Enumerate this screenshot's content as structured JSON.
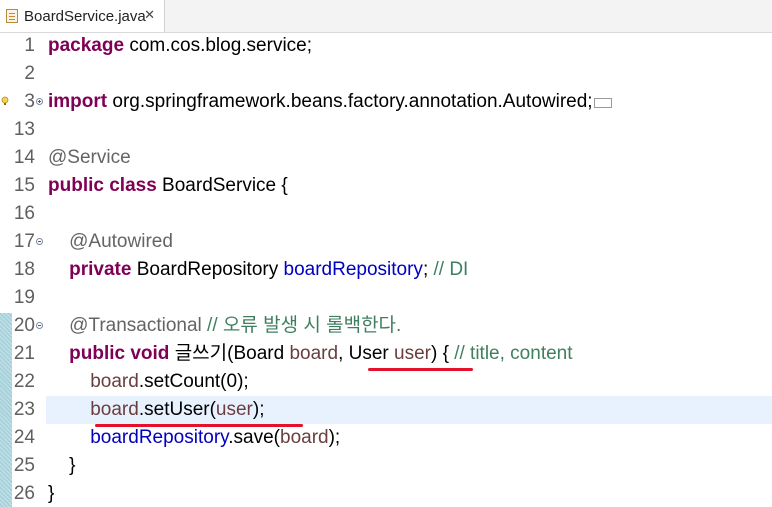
{
  "tab": {
    "title": "BoardService.java",
    "close_glyph": "✕",
    "icon": "java-file-icon"
  },
  "editor": {
    "line_numbers": [
      "1",
      "2",
      "3",
      "13",
      "14",
      "15",
      "16",
      "17",
      "18",
      "19",
      "20",
      "21",
      "22",
      "23",
      "24",
      "25",
      "26"
    ],
    "current_line": "23",
    "lines": [
      [
        [
          "kw",
          "package"
        ],
        [
          "plain",
          " com.cos.blog.service;"
        ]
      ],
      [],
      [
        [
          "kw",
          "import"
        ],
        [
          "plain",
          " org.springframework.beans.factory.annotation.Autowired;"
        ]
      ],
      [],
      [
        [
          "ann",
          "@Service"
        ]
      ],
      [
        [
          "kw",
          "public"
        ],
        [
          "plain",
          " "
        ],
        [
          "kw",
          "class"
        ],
        [
          "plain",
          " BoardService {"
        ]
      ],
      [],
      [
        [
          "plain",
          "    "
        ],
        [
          "ann",
          "@Autowired"
        ]
      ],
      [
        [
          "plain",
          "    "
        ],
        [
          "kw",
          "private"
        ],
        [
          "plain",
          " BoardRepository "
        ],
        [
          "fld",
          "boardRepository"
        ],
        [
          "plain",
          "; "
        ],
        [
          "cmt",
          "// DI"
        ]
      ],
      [],
      [
        [
          "plain",
          "    "
        ],
        [
          "ann",
          "@Transactional"
        ],
        [
          "plain",
          " "
        ],
        [
          "cmt",
          "// 오류 발생 시 롤백한다."
        ]
      ],
      [
        [
          "plain",
          "    "
        ],
        [
          "kw",
          "public"
        ],
        [
          "plain",
          " "
        ],
        [
          "kw",
          "void"
        ],
        [
          "plain",
          " 글쓰기(Board "
        ],
        [
          "par",
          "board"
        ],
        [
          "plain",
          ", User "
        ],
        [
          "par",
          "user"
        ],
        [
          "plain",
          ") { "
        ],
        [
          "cmt",
          "// title, content"
        ]
      ],
      [
        [
          "plain",
          "        "
        ],
        [
          "par",
          "board"
        ],
        [
          "plain",
          ".setCount(0);"
        ]
      ],
      [
        [
          "plain",
          "        "
        ],
        [
          "par",
          "board"
        ],
        [
          "plain",
          ".setUser("
        ],
        [
          "par",
          "user"
        ],
        [
          "plain",
          ");"
        ]
      ],
      [
        [
          "plain",
          "        "
        ],
        [
          "fld",
          "boardRepository"
        ],
        [
          "plain",
          ".save("
        ],
        [
          "par",
          "board"
        ],
        [
          "plain",
          ");"
        ]
      ],
      [
        [
          "plain",
          "    }"
        ]
      ],
      [
        [
          "plain",
          "}"
        ]
      ]
    ]
  },
  "icons": {
    "fold_collapse": "fold-collapse-icon",
    "fold_expand": "fold-expand-icon",
    "warning": "warning-lightbulb-icon"
  },
  "colors": {
    "keyword": "#7f0055",
    "annotation": "#646464",
    "field": "#0000c0",
    "parameter": "#6a3e3e",
    "comment": "#3f7f5f",
    "current_line_bg": "#e8f2fe",
    "underline": "#e3122a"
  }
}
